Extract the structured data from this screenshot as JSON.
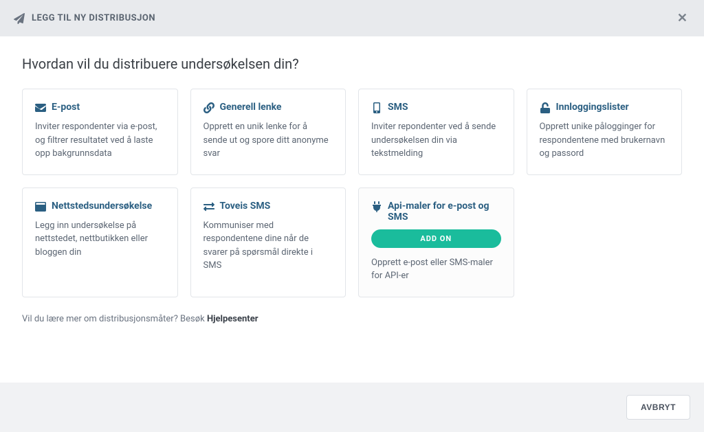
{
  "header": {
    "title": "LEGG TIL NY DISTRIBUSJON"
  },
  "question": "Hvordan vil du distribuere undersøkelsen din?",
  "cards": {
    "email": {
      "title": "E-post",
      "desc": "Inviter respondenter via e-post, og filtrer resultatet ved å laste opp bakgrunnsdata"
    },
    "link": {
      "title": "Generell lenke",
      "desc": "Opprett en unik lenke for å sende ut og spore ditt anonyme svar"
    },
    "sms": {
      "title": "SMS",
      "desc": "Inviter repondenter ved å sende undersøkelsen din via tekstmelding"
    },
    "login": {
      "title": "Innloggingslister",
      "desc": "Opprett unike pålogginger for respondentene med brukernavn og passord"
    },
    "website": {
      "title": "Nettstedsundersøkelse",
      "desc": "Legg inn undersøkelse på nettstedet, nettbutikken eller bloggen din"
    },
    "twoway": {
      "title": "Toveis SMS",
      "desc": "Kommuniser med respondentene dine når de svarer på spørsmål direkte i SMS"
    },
    "api": {
      "title": "Api-maler for e-post og SMS",
      "desc": "Opprett e-post eller SMS-maler for API-er",
      "badge": "ADD ON"
    }
  },
  "help": {
    "text": "Vil du lære mer om distribusjonsmåter? Besøk ",
    "linkLabel": "Hjelpesenter"
  },
  "footer": {
    "cancel": "AVBRYT"
  }
}
